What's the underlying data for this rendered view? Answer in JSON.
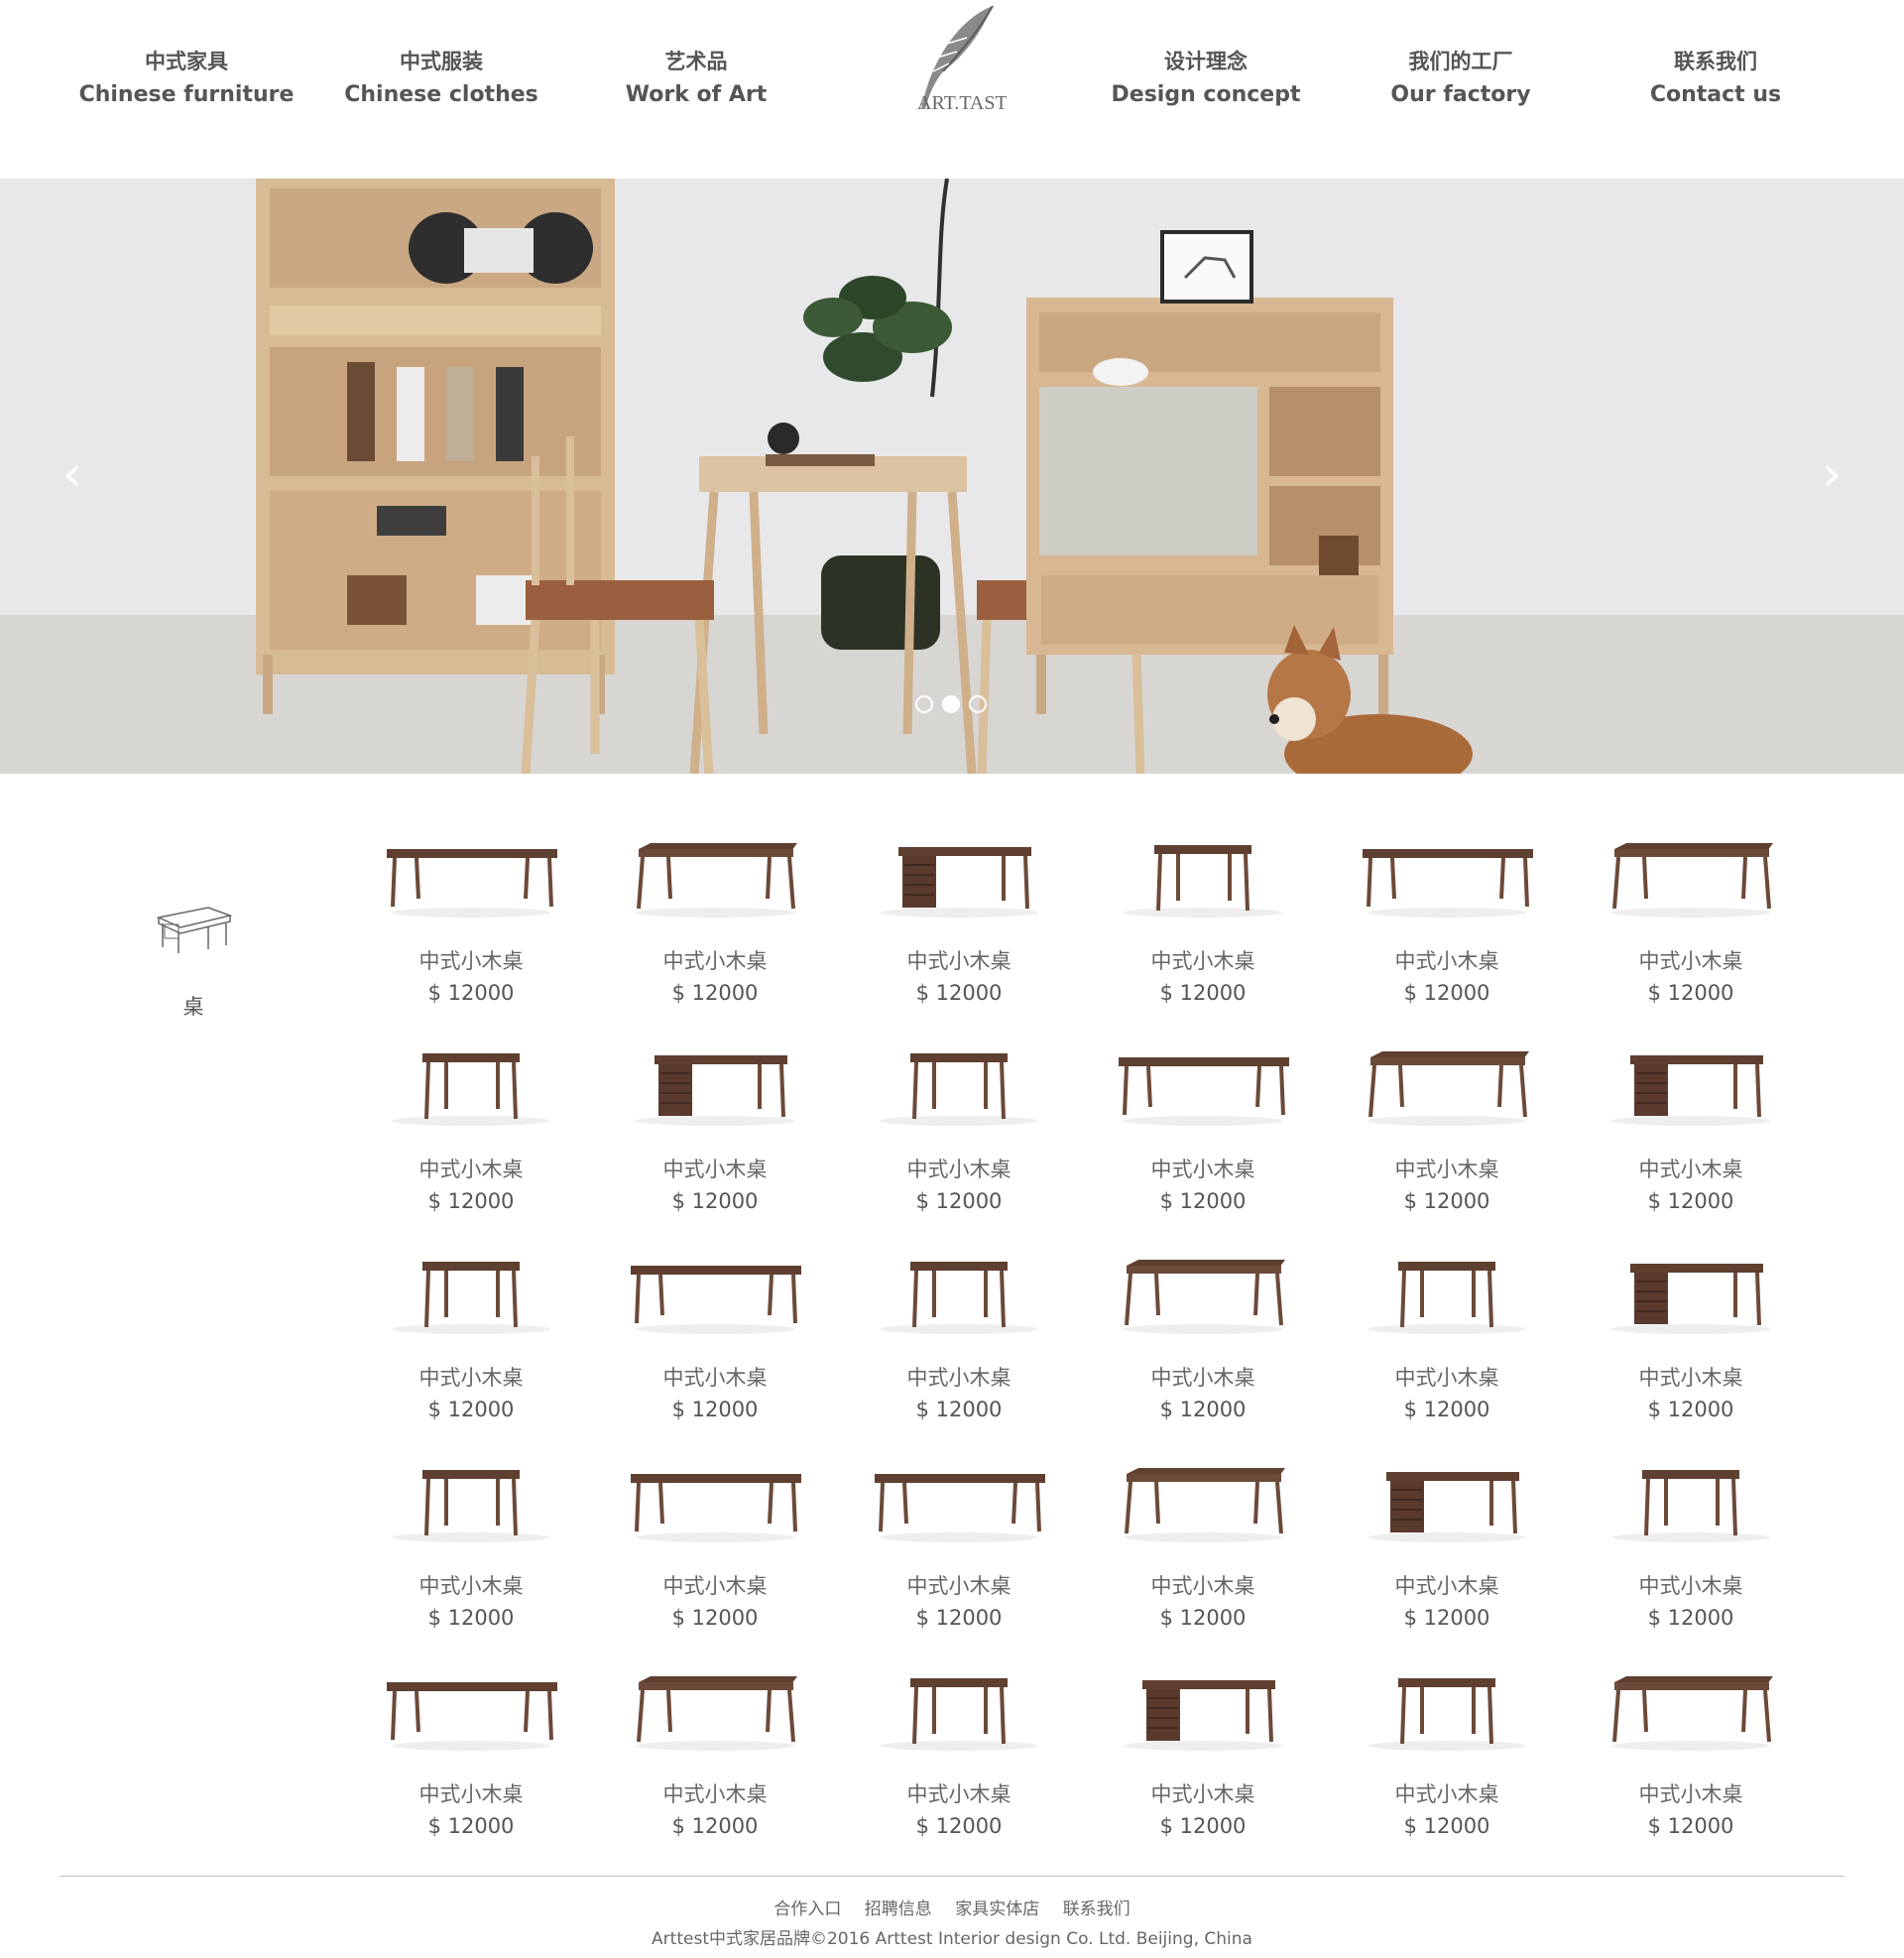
{
  "header": {
    "logo_text": "ART.TASTE",
    "nav": [
      {
        "cn": "中式家具",
        "en": "Chinese furniture"
      },
      {
        "cn": "中式服装",
        "en": "Chinese clothes"
      },
      {
        "cn": "艺术品",
        "en": "Work of Art"
      },
      {
        "cn": "设计理念",
        "en": "Design concept"
      },
      {
        "cn": "我们的工厂",
        "en": "Our factory"
      },
      {
        "cn": "联系我们",
        "en": "Contact us"
      }
    ]
  },
  "carousel": {
    "prev_label": "‹",
    "next_label": "›",
    "slide_count": 3,
    "active_slide": 2
  },
  "category": {
    "icon": "desk-sketch-icon",
    "label": "桌"
  },
  "products": [
    {
      "name": "中式小木桌",
      "price": "$ 12000",
      "variant": "long"
    },
    {
      "name": "中式小木桌",
      "price": "$ 12000",
      "variant": "wide"
    },
    {
      "name": "中式小木桌",
      "price": "$ 12000",
      "variant": "drawer"
    },
    {
      "name": "中式小木桌",
      "price": "$ 12000",
      "variant": "small"
    },
    {
      "name": "中式小木桌",
      "price": "$ 12000",
      "variant": "long"
    },
    {
      "name": "中式小木桌",
      "price": "$ 12000",
      "variant": "wide"
    },
    {
      "name": "中式小木桌",
      "price": "$ 12000",
      "variant": "small"
    },
    {
      "name": "中式小木桌",
      "price": "$ 12000",
      "variant": "drawer"
    },
    {
      "name": "中式小木桌",
      "price": "$ 12000",
      "variant": "small"
    },
    {
      "name": "中式小木桌",
      "price": "$ 12000",
      "variant": "long"
    },
    {
      "name": "中式小木桌",
      "price": "$ 12000",
      "variant": "wide"
    },
    {
      "name": "中式小木桌",
      "price": "$ 12000",
      "variant": "drawer"
    },
    {
      "name": "中式小木桌",
      "price": "$ 12000",
      "variant": "small"
    },
    {
      "name": "中式小木桌",
      "price": "$ 12000",
      "variant": "long"
    },
    {
      "name": "中式小木桌",
      "price": "$ 12000",
      "variant": "small"
    },
    {
      "name": "中式小木桌",
      "price": "$ 12000",
      "variant": "wide"
    },
    {
      "name": "中式小木桌",
      "price": "$ 12000",
      "variant": "small"
    },
    {
      "name": "中式小木桌",
      "price": "$ 12000",
      "variant": "drawer"
    },
    {
      "name": "中式小木桌",
      "price": "$ 12000",
      "variant": "small"
    },
    {
      "name": "中式小木桌",
      "price": "$ 12000",
      "variant": "long"
    },
    {
      "name": "中式小木桌",
      "price": "$ 12000",
      "variant": "long"
    },
    {
      "name": "中式小木桌",
      "price": "$ 12000",
      "variant": "wide"
    },
    {
      "name": "中式小木桌",
      "price": "$ 12000",
      "variant": "drawer"
    },
    {
      "name": "中式小木桌",
      "price": "$ 12000",
      "variant": "small"
    },
    {
      "name": "中式小木桌",
      "price": "$ 12000",
      "variant": "long"
    },
    {
      "name": "中式小木桌",
      "price": "$ 12000",
      "variant": "wide"
    },
    {
      "name": "中式小木桌",
      "price": "$ 12000",
      "variant": "small"
    },
    {
      "name": "中式小木桌",
      "price": "$ 12000",
      "variant": "drawer"
    },
    {
      "name": "中式小木桌",
      "price": "$ 12000",
      "variant": "small"
    },
    {
      "name": "中式小木桌",
      "price": "$ 12000",
      "variant": "wide"
    }
  ],
  "footer": {
    "links": [
      "合作入口",
      "招聘信息",
      "家具实体店",
      "联系我们"
    ],
    "copyright": "Arttest中式家居品牌©2016 Arttest Interior design Co. Ltd. Beijing, China"
  },
  "colors": {
    "text": "#555555",
    "wood_dark": "#6b4a3a",
    "wood_light": "#d9bf9a",
    "wall": "#e9e9ea"
  }
}
